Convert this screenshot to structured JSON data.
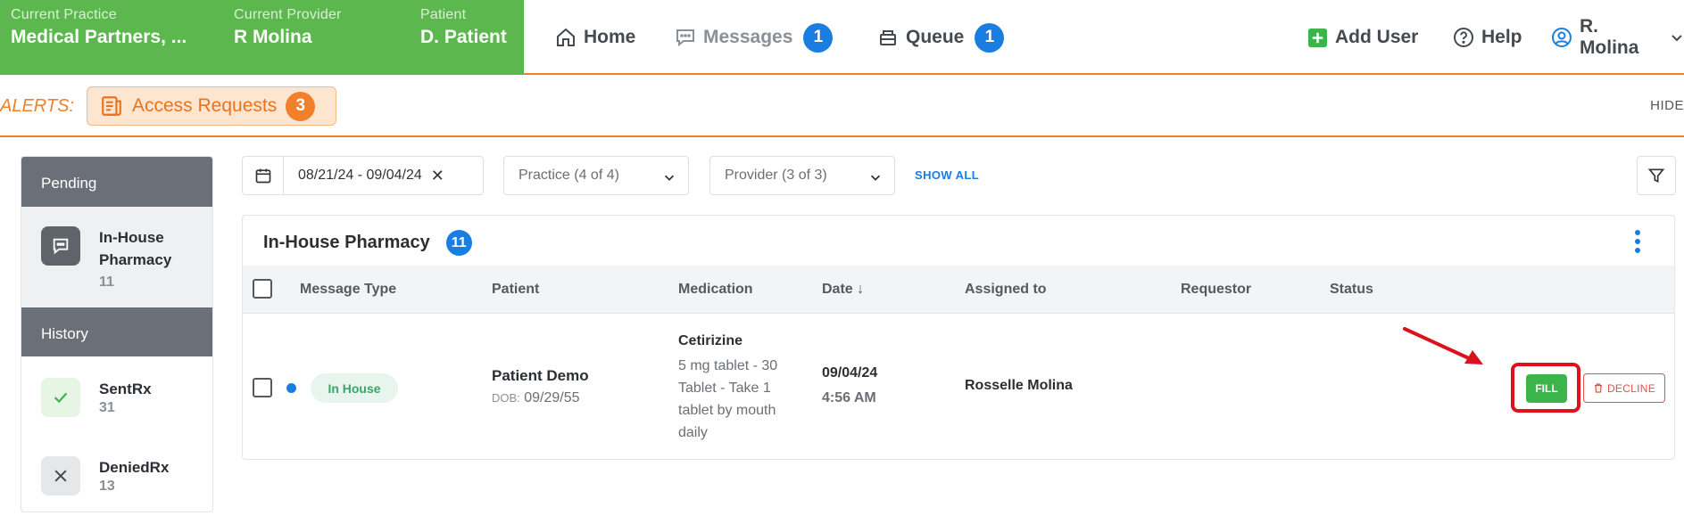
{
  "header": {
    "context": [
      {
        "label": "Current Practice",
        "value": "Medical Partners, ..."
      },
      {
        "label": "Current Provider",
        "value": "R Molina"
      },
      {
        "label": "Patient",
        "value": "D. Patient"
      }
    ],
    "nav": {
      "home": "Home",
      "messages": "Messages",
      "messages_count": "1",
      "queue": "Queue",
      "queue_count": "1",
      "add_user": "Add User",
      "help": "Help",
      "user": "R. Molina"
    }
  },
  "alerts": {
    "label": "ALERTS:",
    "access_requests": "Access Requests",
    "access_requests_count": "3",
    "hide": "HIDE"
  },
  "sidebar": {
    "pending_header": "Pending",
    "history_header": "History",
    "items": [
      {
        "title": "In-House Pharmacy",
        "count": "11",
        "icon": "chat-icon"
      },
      {
        "title": "SentRx",
        "count": "31",
        "icon": "check-icon"
      },
      {
        "title": "DeniedRx",
        "count": "13",
        "icon": "x-icon"
      }
    ]
  },
  "filters": {
    "date_range": "08/21/24 - 09/04/24",
    "date_clear": "✕",
    "practice": "Practice (4 of 4)",
    "provider": "Provider (3 of 3)",
    "show_all": "SHOW ALL"
  },
  "panel": {
    "title": "In-House Pharmacy",
    "count": "11",
    "columns": [
      "Message Type",
      "Patient",
      "Medication",
      "Date ↓",
      "Assigned to",
      "Requestor",
      "Status"
    ],
    "rows": [
      {
        "message_type": "In House",
        "patient_name": "Patient Demo",
        "dob_label": "DOB:",
        "dob": "09/29/55",
        "medication_name": "Cetirizine",
        "medication_detail": "5 mg tablet - 30 Tablet - Take 1 tablet by mouth daily",
        "date": "09/04/24",
        "time": "4:56 AM",
        "assigned_to": "Rosselle Molina",
        "requestor": "",
        "fill_label": "FILL",
        "decline_label": "DECLINE"
      }
    ]
  },
  "colors": {
    "brand_green": "#5cb84e",
    "accent_orange": "#f0802a",
    "badge_blue": "#1a7de0",
    "highlight_red": "#e0101c"
  }
}
